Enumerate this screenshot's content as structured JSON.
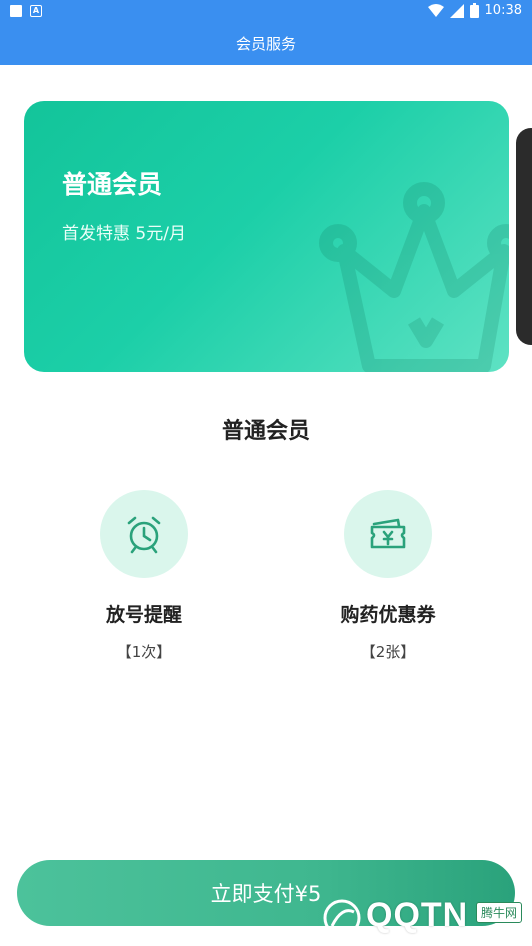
{
  "status_bar": {
    "time": "10:38"
  },
  "header": {
    "title": "会员服务"
  },
  "card": {
    "title": "普通会员",
    "subtitle": "首发特惠 5元/月"
  },
  "section": {
    "title": "普通会员"
  },
  "benefits": [
    {
      "name": "放号提醒",
      "count": "【1次】",
      "icon": "alarm-clock-icon"
    },
    {
      "name": "购药优惠券",
      "count": "【2张】",
      "icon": "yuan-coupon-icon"
    }
  ],
  "pay_button": {
    "label": "立即支付¥5"
  },
  "watermark": {
    "text": "QQTN",
    "badge": "腾牛网"
  },
  "colors": {
    "header": "#3a8ff0",
    "card": "#1ccfa8",
    "accent": "#2aa27b",
    "icon_bg": "#daf6ec"
  }
}
